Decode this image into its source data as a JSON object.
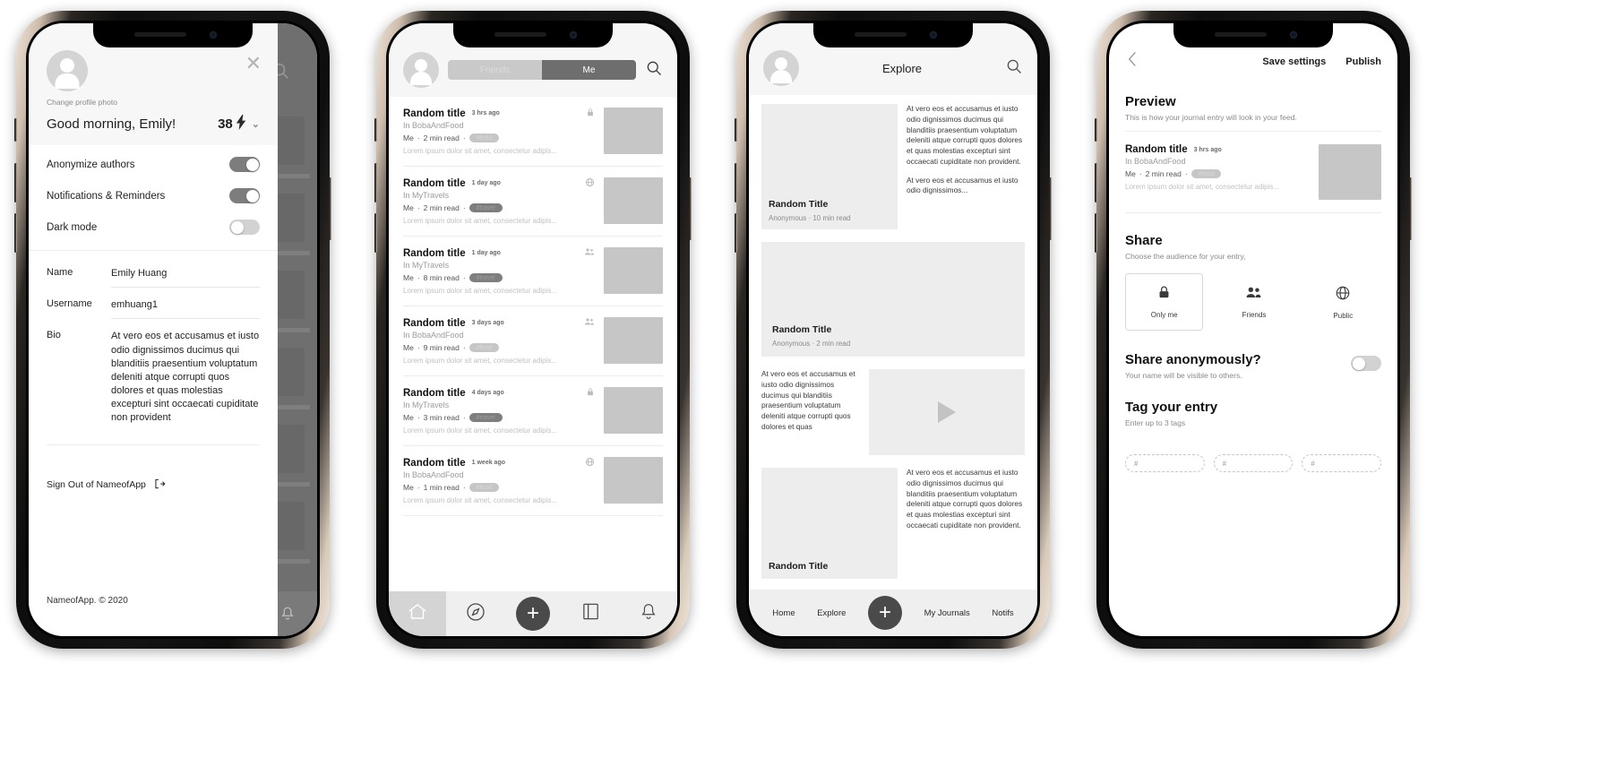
{
  "phone1": {
    "close_icon": "close-icon",
    "change_photo": "Change profile photo",
    "greeting": "Good morning, Emily!",
    "score": "38",
    "bolt": "⚡",
    "chevron": "⌄",
    "toggles": [
      {
        "label": "Anonymize authors",
        "state": "on"
      },
      {
        "label": "Notifications & Reminders",
        "state": "on"
      },
      {
        "label": "Dark mode",
        "state": "off"
      }
    ],
    "fields": [
      {
        "label": "Name",
        "value": "Emily Huang"
      },
      {
        "label": "Username",
        "value": "emhuang1"
      },
      {
        "label": "Bio",
        "value": "At vero eos et accusamus et iusto odio dignissimos ducimus qui blanditiis praesentium voluptatum deleniti atque corrupti quos dolores et quas molestias excepturi sint occaecati cupiditate non provident"
      }
    ],
    "sign_out": "Sign Out of NameofApp",
    "copyright": "NameofApp. © 2020"
  },
  "phone2": {
    "tabs": [
      {
        "label": "Friends",
        "active": false
      },
      {
        "label": "Me",
        "active": true
      }
    ],
    "search_icon": "search-icon",
    "feed": [
      {
        "title": "Random title",
        "time": "3 hrs ago",
        "privacy": "lock-icon",
        "journal": "In BobaAndFood",
        "author": "Me",
        "read": "2 min read",
        "tag": "#food",
        "tag_style": "light",
        "excerpt": "Lorem ipsum dolor sit amet, consectetur adipis..."
      },
      {
        "title": "Random title",
        "time": "1 day ago",
        "privacy": "globe-icon",
        "journal": "In MyTravels",
        "author": "Me",
        "read": "2 min read",
        "tag": "#travel",
        "tag_style": "dark",
        "excerpt": "Lorem ipsum dolor sit amet, consectetur adipis..."
      },
      {
        "title": "Random title",
        "time": "1 day ago",
        "privacy": "people-icon",
        "journal": "In MyTravels",
        "author": "Me",
        "read": "8 min read",
        "tag": "#travel",
        "tag_style": "dark",
        "excerpt": "Lorem ipsum dolor sit amet, consectetur adipis..."
      },
      {
        "title": "Random title",
        "time": "3 days ago",
        "privacy": "people-icon",
        "journal": "In BobaAndFood",
        "author": "Me",
        "read": "9 min read",
        "tag": "#food",
        "tag_style": "light",
        "excerpt": "Lorem ipsum dolor sit amet, consectetur adipis..."
      },
      {
        "title": "Random title",
        "time": "4 days ago",
        "privacy": "lock-icon",
        "journal": "In MyTravels",
        "author": "Me",
        "read": "3 min read",
        "tag": "#travel",
        "tag_style": "dark",
        "excerpt": "Lorem ipsum dolor sit amet, consectetur adipis..."
      },
      {
        "title": "Random title",
        "time": "1 week ago",
        "privacy": "globe-icon",
        "journal": "In BobaAndFood",
        "author": "Me",
        "read": "1 min read",
        "tag": "#food",
        "tag_style": "light",
        "excerpt": "Lorem ipsum dolor sit amet, consectetur adipis..."
      }
    ],
    "nav": [
      {
        "icon": "home-icon",
        "active": true
      },
      {
        "icon": "compass-icon",
        "active": false
      },
      {
        "icon": "plus-icon",
        "active": false
      },
      {
        "icon": "notebook-icon",
        "active": false
      },
      {
        "icon": "bell-icon",
        "active": false
      }
    ]
  },
  "phone3": {
    "title": "Explore",
    "search_icon": "search-icon",
    "cards": [
      {
        "kind": "image-left",
        "title": "Random Title",
        "meta": "Anonymous · 10 min read",
        "text": "At vero eos et accusamus et iusto odio dignissimos ducimus qui blanditiis praesentium voluptatum deleniti atque corrupti quos dolores et quas molestias excepturi sint occaecati cupiditate non provident.",
        "text2": "At vero eos et accusamus et iusto odio dignissimos..."
      },
      {
        "kind": "wide",
        "title": "Random Title",
        "meta": "Anonymous · 2 min read"
      },
      {
        "kind": "video",
        "text": "At vero eos et accusamus et iusto odio dignissimos ducimus qui blanditiis praesentium voluptatum deleniti atque corrupti quos dolores et quas",
        "play_icon": "play-icon"
      },
      {
        "kind": "image-left",
        "title": "Random Title",
        "text": "At vero eos et accusamus et iusto odio dignissimos ducimus qui blanditiis praesentium voluptatum deleniti atque corrupti quos dolores et quas molestias excepturi sint occaecati cupiditate non provident."
      }
    ],
    "nav": [
      {
        "label": "Home"
      },
      {
        "label": "Explore"
      },
      {
        "label": "My Journals"
      },
      {
        "label": "Notifs"
      }
    ],
    "fab": "+"
  },
  "phone4": {
    "back_icon": "back-chevron-icon",
    "save_label": "Save settings",
    "publish_label": "Publish",
    "preview": {
      "heading": "Preview",
      "sub": "This is how your journal entry will look in your feed.",
      "title": "Random title",
      "time": "3 hrs ago",
      "journal": "In BobaAndFood",
      "author": "Me",
      "read": "2 min read",
      "tag": "#food",
      "excerpt": "Lorem ipsum dolor sit amet, consectetur adipis..."
    },
    "share": {
      "heading": "Share",
      "sub": "Choose the audience for your entry,",
      "options": [
        {
          "label": "Only me",
          "icon": "lock-icon",
          "selected": true
        },
        {
          "label": "Friends",
          "icon": "people-icon",
          "selected": false
        },
        {
          "label": "Public",
          "icon": "globe-icon",
          "selected": false
        }
      ]
    },
    "anonymous": {
      "heading": "Share anonymously?",
      "sub": "Your name will be visible to others.",
      "state": "off"
    },
    "tags": {
      "heading": "Tag your entry",
      "sub": "Enter up to 3 tags",
      "placeholder": "#",
      "inputs": [
        "#",
        "#",
        "#"
      ]
    }
  }
}
